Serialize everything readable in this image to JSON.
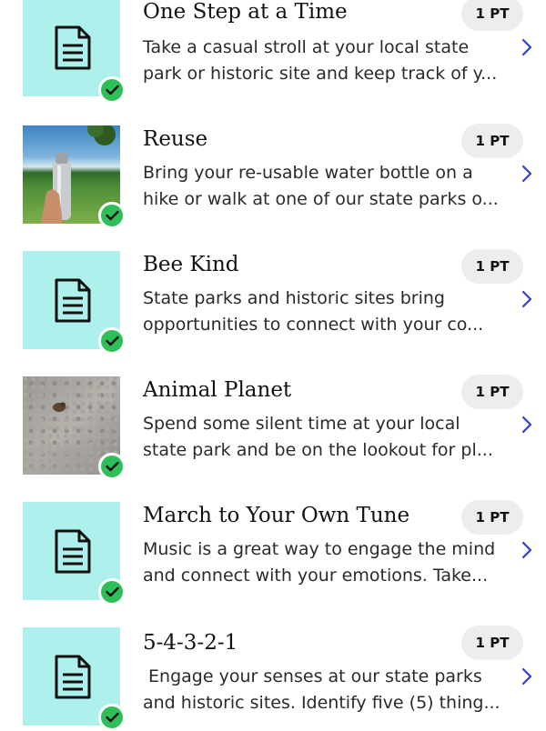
{
  "colors": {
    "icon_tile": "#aef0ec",
    "check": "#2fbf58",
    "chevron": "#2f3fd6",
    "pill": "#efecec"
  },
  "activities": [
    {
      "title": "One Step at a Time",
      "points": "1 PT",
      "thumbnail": "document-icon",
      "description": "Take a casual stroll at your local state park or historic site and keep track of y..."
    },
    {
      "title": "Reuse",
      "points": "1 PT",
      "thumbnail": "photo-water-bottle",
      "description": "Bring your re-usable water bottle on a hike or walk at one of our state parks o..."
    },
    {
      "title": "Bee Kind",
      "points": "1 PT",
      "thumbnail": "document-icon",
      "description": "State parks and historic sites bring opportunities to connect with your co..."
    },
    {
      "title": "Animal Planet",
      "points": "1 PT",
      "thumbnail": "photo-ground",
      "description": "Spend some silent time at your local state park and be on the lookout for pl..."
    },
    {
      "title": "March to Your Own Tune",
      "points": "1 PT",
      "thumbnail": "document-icon",
      "description": "Music is a great way to engage the mind and connect with your emotions. Take..."
    },
    {
      "title": "5-4-3-2-1",
      "points": "1 PT",
      "thumbnail": "document-icon",
      "description": " Engage your senses at our state parks and historic sites. Identify five (5) thing..."
    }
  ]
}
